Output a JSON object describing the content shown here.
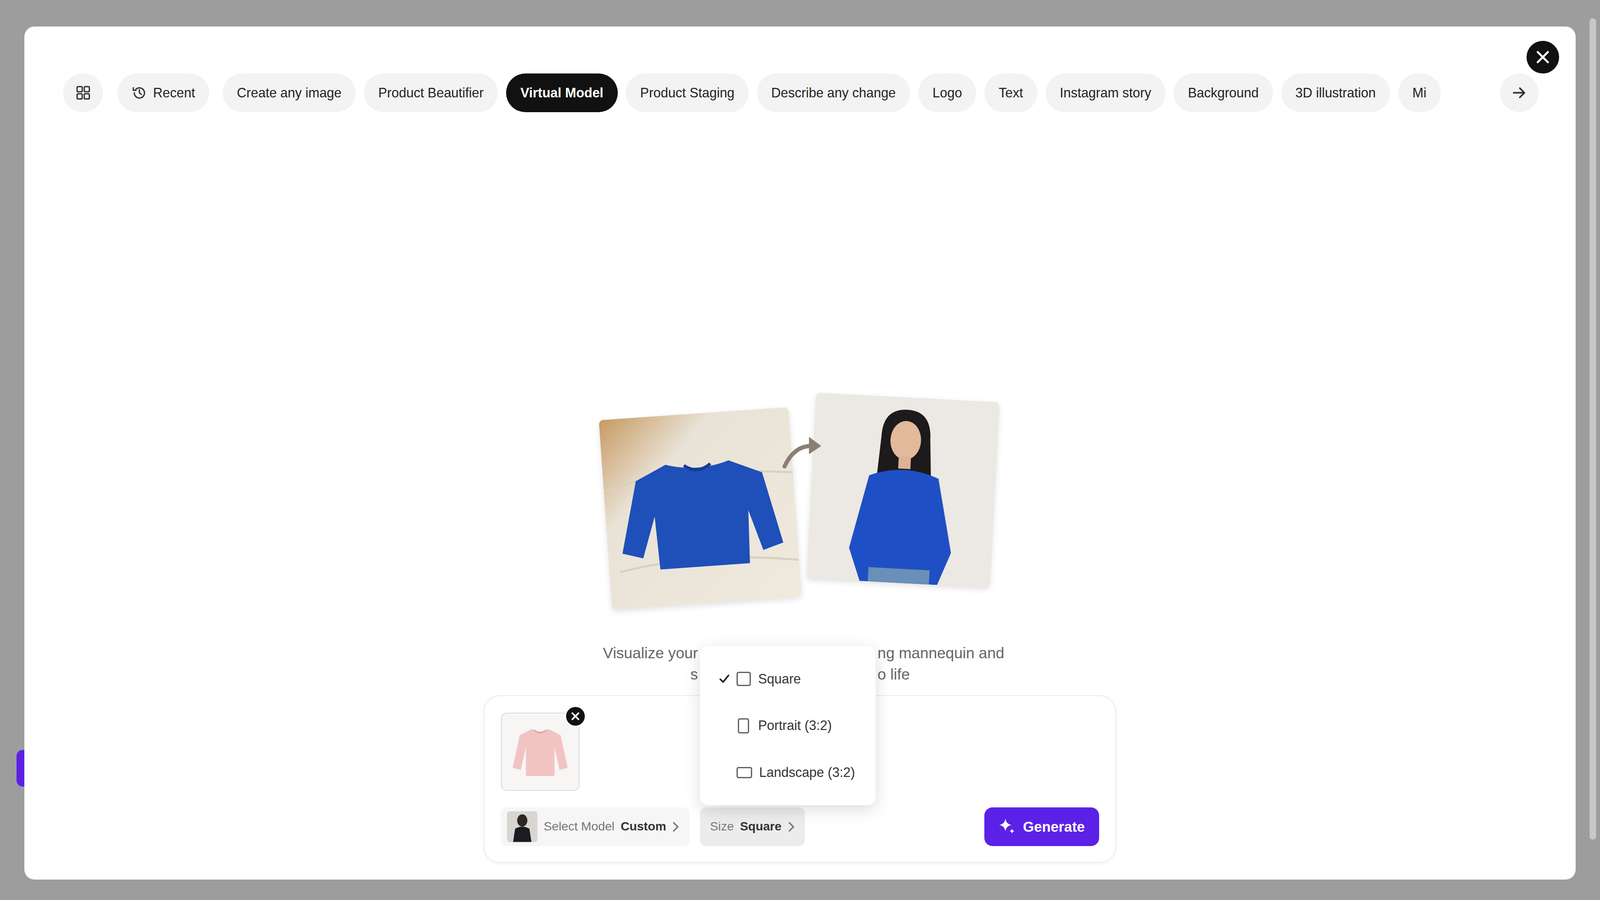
{
  "tabs": {
    "items": [
      {
        "label": "Recent",
        "selected": false,
        "kind": "history"
      },
      {
        "label": "Create any image",
        "selected": false,
        "kind": "plain"
      },
      {
        "label": "Product Beautifier",
        "selected": false,
        "kind": "plain"
      },
      {
        "label": "Virtual Model",
        "selected": true,
        "kind": "plain"
      },
      {
        "label": "Product Staging",
        "selected": false,
        "kind": "plain"
      },
      {
        "label": "Describe any change",
        "selected": false,
        "kind": "plain"
      },
      {
        "label": "Logo",
        "selected": false,
        "kind": "plain"
      },
      {
        "label": "Text",
        "selected": false,
        "kind": "plain"
      },
      {
        "label": "Instagram story",
        "selected": false,
        "kind": "plain"
      },
      {
        "label": "Background",
        "selected": false,
        "kind": "plain"
      },
      {
        "label": "3D illustration",
        "selected": false,
        "kind": "plain"
      },
      {
        "label": "Mi",
        "selected": false,
        "kind": "plain"
      }
    ]
  },
  "hero": {
    "description": [
      [
        "Visualize your",
        "ng mannequin and"
      ],
      [
        "s",
        "o life"
      ]
    ]
  },
  "prompt": {
    "model": {
      "label": "Select Model",
      "value": "Custom"
    },
    "size": {
      "label": "Size",
      "value": "Square",
      "active": true
    },
    "generate": {
      "label": "Generate"
    }
  },
  "size_menu": {
    "open": true,
    "options": [
      {
        "label": "Square",
        "selected": true,
        "kind": "square"
      },
      {
        "label": "Portrait (3:2)",
        "selected": false,
        "kind": "portrait"
      },
      {
        "label": "Landscape (3:2)",
        "selected": false,
        "kind": "landscape"
      }
    ]
  }
}
